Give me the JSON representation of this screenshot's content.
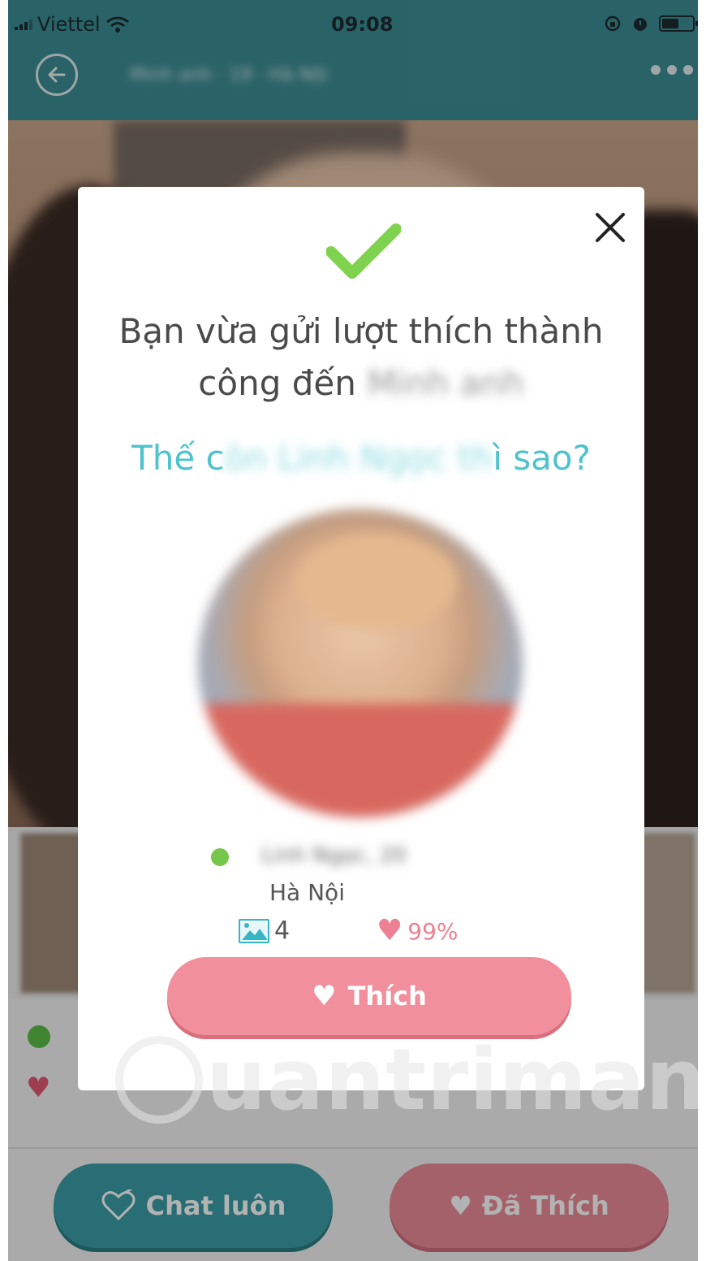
{
  "status_bar": {
    "carrier": "Viettel",
    "time": "09:08",
    "icons": [
      "signal-icon",
      "wifi-icon",
      "orientation-lock-icon",
      "alarm-icon",
      "battery-icon"
    ]
  },
  "header": {
    "back_icon": "back-arrow-icon",
    "title": "Minh anh · 19 · Hà Nội",
    "more_icon": "more-dots-icon"
  },
  "modal": {
    "close_icon": "close-icon",
    "check_icon": "check-icon",
    "title": "Bạn vừa gửi lượt thích thành công đến",
    "title_name": "Minh anh",
    "question_prefix": "Thế c",
    "question_hidden": "òn Linh Ngọc th",
    "question_suffix": "ì sao?",
    "profile": {
      "online": true,
      "name": "Linh Ngọc, 20",
      "location": "Hà Nội",
      "photo_count": "4",
      "match_percent": "99%"
    },
    "like_button": "Thích"
  },
  "bottom_actions": {
    "chat_button": "Chat luôn",
    "liked_button": "Đã Thích"
  },
  "watermark": "uantrimang",
  "colors": {
    "header": "#3c8e95",
    "teal_text": "#4fc3cd",
    "check_green": "#7ed24e",
    "online_green": "#76c64b",
    "pink": "#f1909c",
    "heart_pink": "#ee8093"
  }
}
